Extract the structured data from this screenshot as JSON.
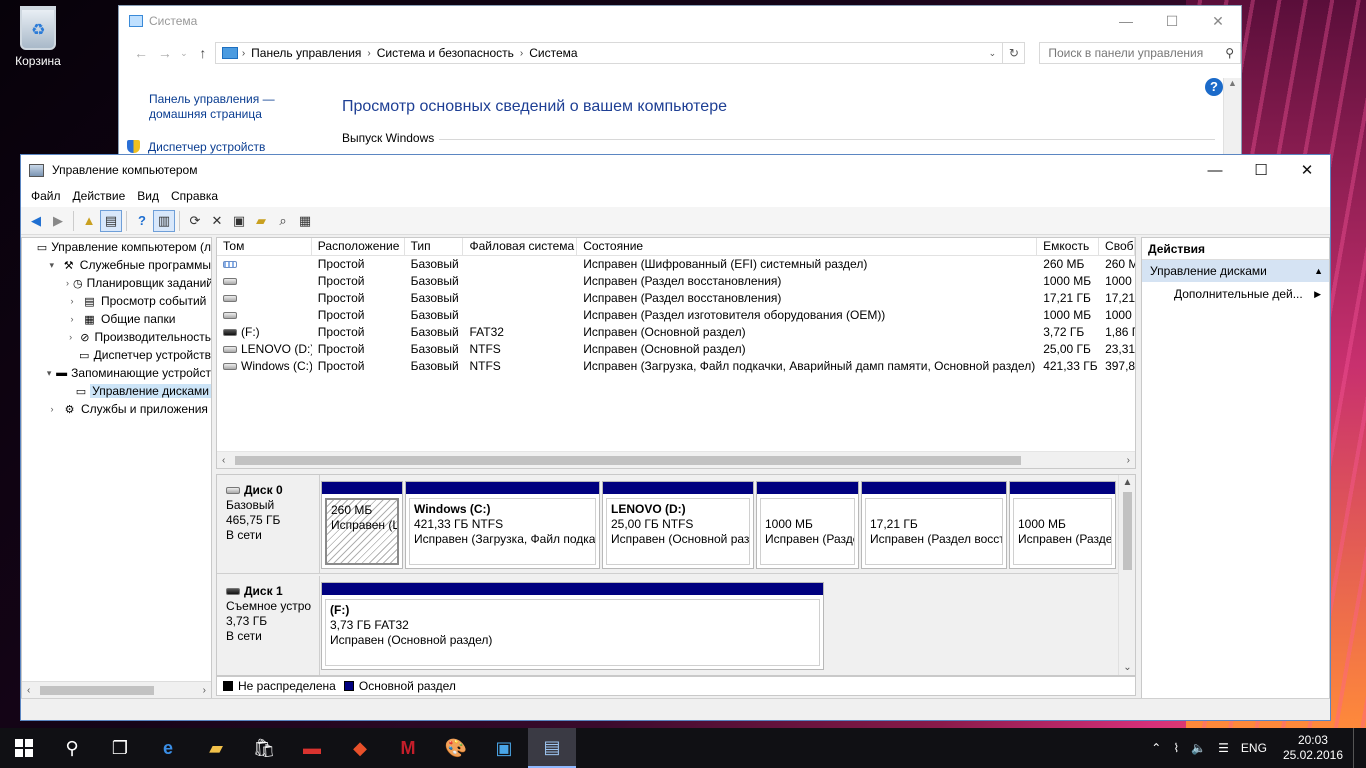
{
  "desktop": {
    "recycle_bin_label": "Корзина"
  },
  "system_window": {
    "title": "Система",
    "breadcrumbs": [
      "Панель управления",
      "Система и безопасность",
      "Система"
    ],
    "search_placeholder": "Поиск в панели управления",
    "left_link_1": "Панель управления —",
    "left_link_2": "домашняя страница",
    "device_manager_link": "Диспетчер устройств",
    "heading": "Просмотр основных сведений о вашем компьютере",
    "edition_label": "Выпуск Windows",
    "help_label": "?"
  },
  "window": {
    "title": "Управление компьютером",
    "menu": [
      "Файл",
      "Действие",
      "Вид",
      "Справка"
    ]
  },
  "tree": [
    {
      "label": "Управление компьютером (л",
      "level": 0,
      "exp": "",
      "icon": "computer-icon"
    },
    {
      "label": "Служебные программы",
      "level": 1,
      "exp": "▾",
      "icon": "tools-icon"
    },
    {
      "label": "Планировщик заданий",
      "level": 2,
      "exp": "›",
      "icon": "clock-icon"
    },
    {
      "label": "Просмотр событий",
      "level": 2,
      "exp": "›",
      "icon": "event-viewer-icon"
    },
    {
      "label": "Общие папки",
      "level": 2,
      "exp": "›",
      "icon": "shared-folder-icon"
    },
    {
      "label": "Производительность",
      "level": 2,
      "exp": "›",
      "icon": "performance-icon"
    },
    {
      "label": "Диспетчер устройств",
      "level": 2,
      "exp": "",
      "icon": "device-manager-icon"
    },
    {
      "label": "Запоминающие устройст",
      "level": 1,
      "exp": "▾",
      "icon": "storage-icon"
    },
    {
      "label": "Управление дисками",
      "level": 2,
      "exp": "",
      "icon": "disk-management-icon",
      "selected": true
    },
    {
      "label": "Службы и приложения",
      "level": 1,
      "exp": "›",
      "icon": "services-icon"
    }
  ],
  "volumes": {
    "columns": [
      "Том",
      "Расположение",
      "Тип",
      "Файловая система",
      "Состояние",
      "Емкость",
      "Своб"
    ],
    "rows": [
      {
        "name": "",
        "icon": "striped",
        "layout": "Простой",
        "type": "Базовый",
        "fs": "",
        "status": "Исправен (Шифрованный (EFI) системный раздел)",
        "capacity": "260 МБ",
        "free": "260 М"
      },
      {
        "name": "",
        "icon": "light",
        "layout": "Простой",
        "type": "Базовый",
        "fs": "",
        "status": "Исправен (Раздел восстановления)",
        "capacity": "1000 МБ",
        "free": "1000 I"
      },
      {
        "name": "",
        "icon": "light",
        "layout": "Простой",
        "type": "Базовый",
        "fs": "",
        "status": "Исправен (Раздел восстановления)",
        "capacity": "17,21 ГБ",
        "free": "17,21"
      },
      {
        "name": "",
        "icon": "light",
        "layout": "Простой",
        "type": "Базовый",
        "fs": "",
        "status": "Исправен (Раздел изготовителя оборудования (OEM))",
        "capacity": "1000 МБ",
        "free": "1000 I"
      },
      {
        "name": "(F:)",
        "icon": "dark",
        "layout": "Простой",
        "type": "Базовый",
        "fs": "FAT32",
        "status": "Исправен (Основной раздел)",
        "capacity": "3,72 ГБ",
        "free": "1,86 Г"
      },
      {
        "name": "LENOVO (D:)",
        "icon": "light",
        "layout": "Простой",
        "type": "Базовый",
        "fs": "NTFS",
        "status": "Исправен (Основной раздел)",
        "capacity": "25,00 ГБ",
        "free": "23,31"
      },
      {
        "name": "Windows (C:)",
        "icon": "light",
        "layout": "Простой",
        "type": "Базовый",
        "fs": "NTFS",
        "status": "Исправен (Загрузка, Файл подкачки, Аварийный дамп памяти, Основной раздел)",
        "capacity": "421,33 ГБ",
        "free": "397,8"
      }
    ]
  },
  "disks": [
    {
      "name": "Диск 0",
      "kind": "Базовый",
      "size": "465,75 ГБ",
      "state": "В сети",
      "partitions": [
        {
          "name": "",
          "size": "260 МБ",
          "status": "Исправен (Ш",
          "hatched": true
        },
        {
          "name": "Windows  (C:)",
          "size": "421,33 ГБ NTFS",
          "status": "Исправен (Загрузка, Файл подкач"
        },
        {
          "name": "LENOVO  (D:)",
          "size": "25,00 ГБ NTFS",
          "status": "Исправен (Основной раз"
        },
        {
          "name": "",
          "size": "1000 МБ",
          "status": "Исправен (Разде"
        },
        {
          "name": "",
          "size": "17,21 ГБ",
          "status": "Исправен (Раздел восст"
        },
        {
          "name": "",
          "size": "1000 МБ",
          "status": "Исправен (Разде"
        }
      ]
    },
    {
      "name": "Диск 1",
      "kind": "Съемное устро",
      "size": "3,73 ГБ",
      "state": "В сети",
      "partitions": [
        {
          "name": "(F:)",
          "size": "3,73 ГБ FAT32",
          "status": "Исправен (Основной раздел)"
        }
      ]
    }
  ],
  "legend": [
    {
      "label": "Не распределена",
      "color": "#000000"
    },
    {
      "label": "Основной раздел",
      "color": "#00007f"
    }
  ],
  "actions": {
    "header": "Действия",
    "section": "Управление дисками",
    "more": "Дополнительные дей..."
  },
  "taskbar": {
    "language": "ENG",
    "time": "20:03",
    "date": "25.02.2016"
  }
}
